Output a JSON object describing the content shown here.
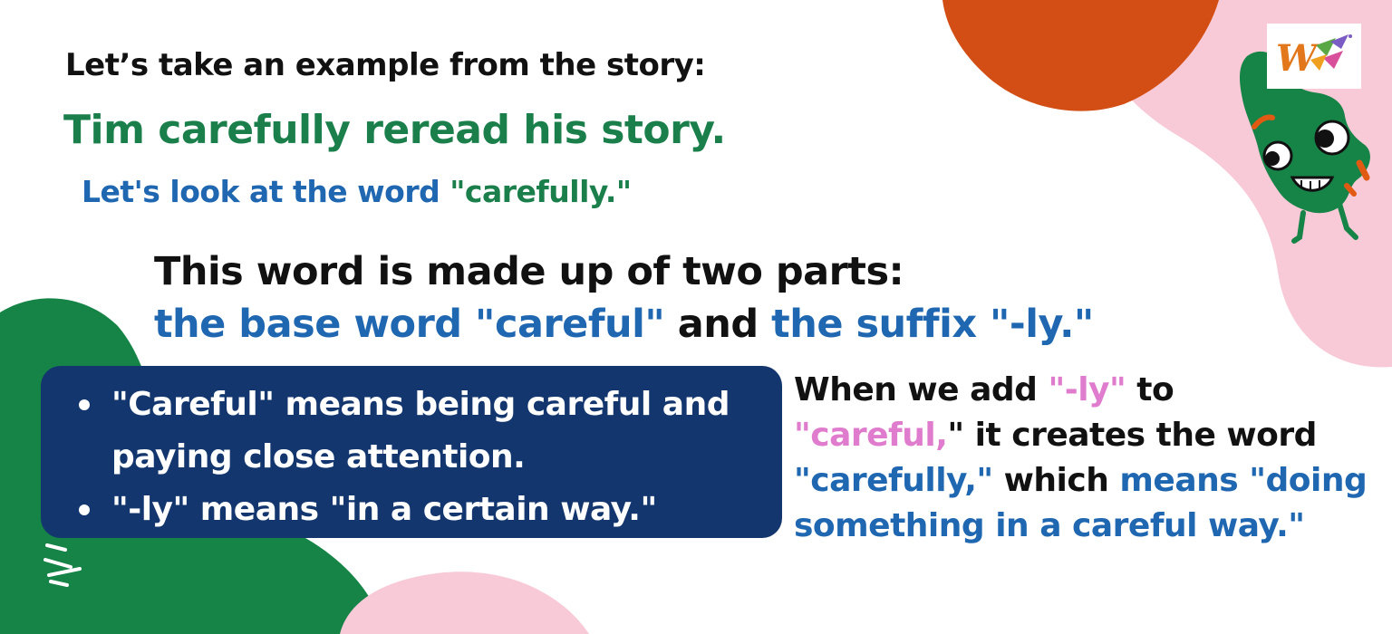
{
  "intro": "Let’s take an example from the story:",
  "example_sentence": "Tim carefully reread his story.",
  "look_at": {
    "prefix": "Let's look at the word ",
    "word": "\"carefully.\""
  },
  "parts": {
    "line1": "This word is made up of two parts:",
    "base": "the base word \"careful\"",
    "and": " and ",
    "suffix": "the suffix \"-ly.\""
  },
  "bullets": [
    "\"Careful\" means being careful and paying close attention.",
    "\"-ly\" means \"in a certain way.\""
  ],
  "explanation": {
    "t1": "When we add ",
    "t2": "\"-ly\"",
    "t3": " to ",
    "t4": "\"careful,",
    "t5": "\" it creates the word ",
    "t6": "\"carefully,\"",
    "t7": " which ",
    "t8": "means \"doing something in a careful way.\""
  },
  "colors": {
    "green_text": "#1a7f4b",
    "blue_text": "#1f67b1",
    "pink_text": "#e07ccd",
    "card_bg": "#12366d",
    "blob_orange": "#d24e14",
    "blob_pink": "#f8c9d6",
    "blob_green": "#168447"
  },
  "icons": {
    "logo": "w-logo-icon",
    "mascot": "green-leaf-mascot-icon"
  }
}
